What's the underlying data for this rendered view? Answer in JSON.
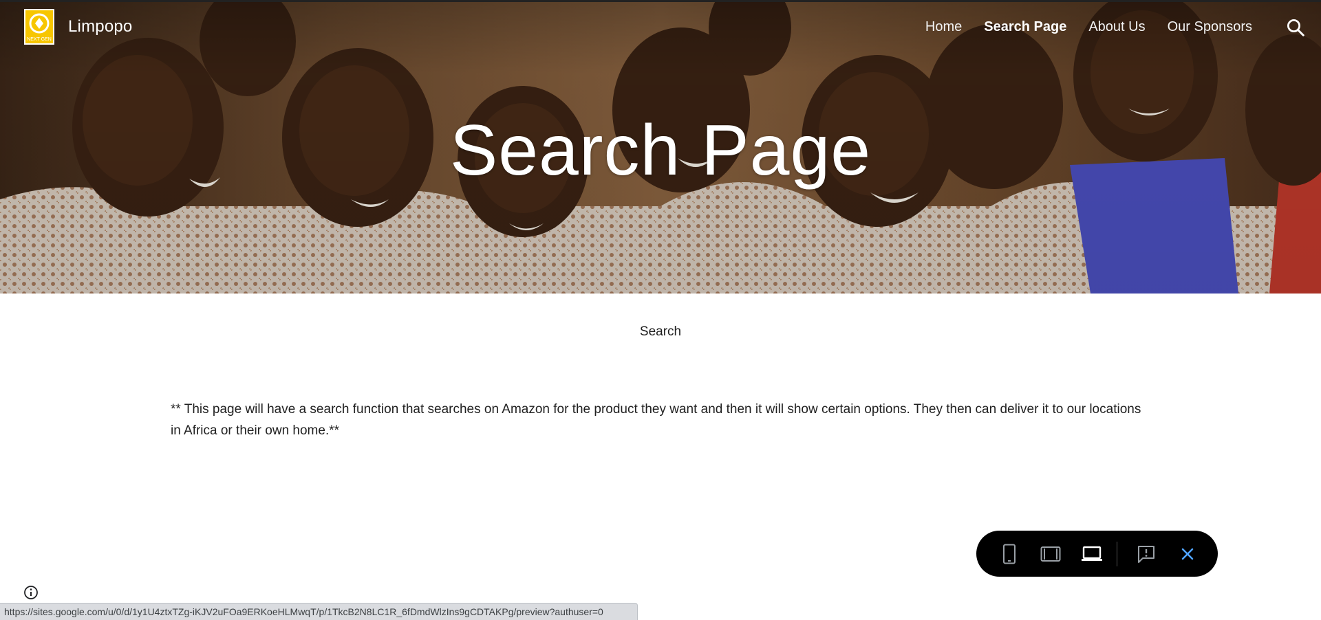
{
  "header": {
    "site_title": "Limpopo",
    "logo_text": "NEXT GEN",
    "nav": [
      {
        "label": "Home",
        "active": false
      },
      {
        "label": "Search Page",
        "active": true
      },
      {
        "label": "About Us",
        "active": false
      },
      {
        "label": "Our Sponsors",
        "active": false
      }
    ],
    "search_icon": "search-icon"
  },
  "hero": {
    "title": "Search Page"
  },
  "main": {
    "heading": "Search",
    "description": "** This page will have a search function that searches on Amazon for the product they want and then it will show certain options. They then can deliver it to our locations in Africa or their own home.**"
  },
  "preview_toolbar": {
    "buttons": [
      "phone-preview-icon",
      "tablet-preview-icon",
      "laptop-preview-icon",
      "report-abuse-icon",
      "close-icon"
    ],
    "active_button": "laptop-preview-icon",
    "close_color": "#4fa3ff"
  },
  "status_bar": {
    "url": "https://sites.google.com/u/0/d/1y1U4ztxTZg-iKJV2uFOa9ERKoeHLMwqT/p/1TkcB2N8LC1R_6fDmdWlzIns9gCDTAKPg/preview?authuser=0"
  },
  "colors": {
    "accent": "#f7c600",
    "toolbar_bg": "#000000"
  }
}
